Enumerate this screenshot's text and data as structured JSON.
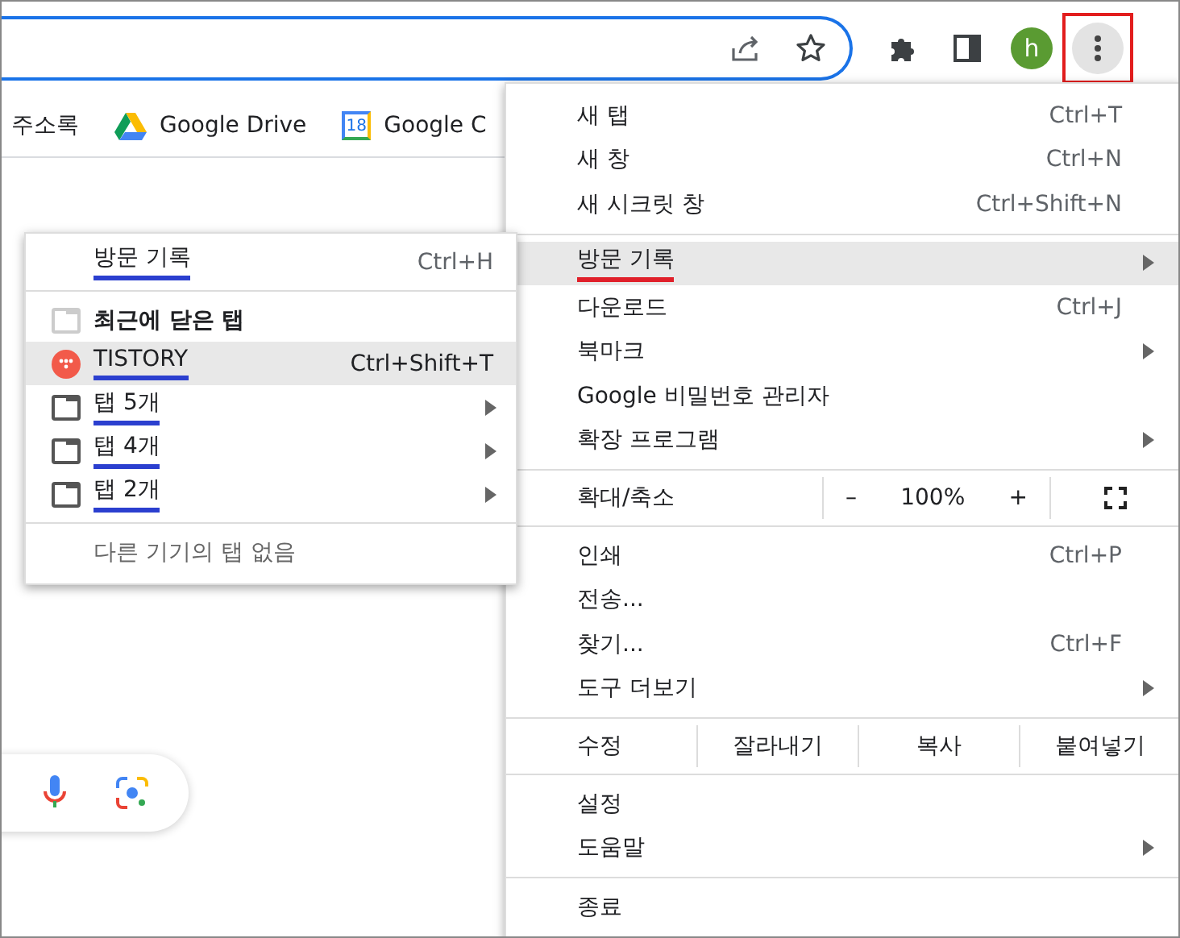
{
  "toolbar": {
    "avatar": "h",
    "menu_button_highlighted": true
  },
  "bookmarks": [
    {
      "label": "주소록",
      "kind": "plain"
    },
    {
      "label": "Google Drive",
      "kind": "drive"
    },
    {
      "label": "Google C",
      "kind": "calendar",
      "icon_text": "18"
    }
  ],
  "main_menu": [
    {
      "kind": "item",
      "label": "새 탭",
      "shortcut": "Ctrl+T",
      "submenu": false,
      "selected": false,
      "underlined": false
    },
    {
      "kind": "item",
      "label": "새 창",
      "shortcut": "Ctrl+N",
      "submenu": false,
      "selected": false,
      "underlined": false
    },
    {
      "kind": "item",
      "label": "새 시크릿 창",
      "shortcut": "Ctrl+Shift+N",
      "submenu": false,
      "selected": false,
      "underlined": false
    },
    {
      "kind": "divider"
    },
    {
      "kind": "item",
      "label": "방문 기록",
      "submenu": true,
      "selected": true,
      "underlined": true
    },
    {
      "kind": "item",
      "label": "다운로드",
      "shortcut": "Ctrl+J",
      "submenu": false,
      "selected": false,
      "underlined": false
    },
    {
      "kind": "item",
      "label": "북마크",
      "submenu": true,
      "selected": false,
      "underlined": false
    },
    {
      "kind": "item",
      "label": "Google 비밀번호 관리자",
      "submenu": false,
      "selected": false,
      "underlined": false
    },
    {
      "kind": "item",
      "label": "확장 프로그램",
      "submenu": true,
      "selected": false,
      "underlined": false
    },
    {
      "kind": "divider"
    },
    {
      "kind": "zoom",
      "label": "확대/축소",
      "minus": "–",
      "value": "100%",
      "plus": "+"
    },
    {
      "kind": "divider"
    },
    {
      "kind": "item",
      "label": "인쇄",
      "shortcut": "Ctrl+P",
      "submenu": false,
      "selected": false,
      "underlined": false
    },
    {
      "kind": "item",
      "label": "전송...",
      "submenu": false,
      "selected": false,
      "underlined": false
    },
    {
      "kind": "item",
      "label": "찾기...",
      "shortcut": "Ctrl+F",
      "submenu": false,
      "selected": false,
      "underlined": false
    },
    {
      "kind": "item",
      "label": "도구 더보기",
      "submenu": true,
      "selected": false,
      "underlined": false
    },
    {
      "kind": "divider"
    },
    {
      "kind": "edit",
      "label": "수정",
      "actions": [
        "잘라내기",
        "복사",
        "붙여넣기"
      ]
    },
    {
      "kind": "divider"
    },
    {
      "kind": "item",
      "label": "설정",
      "submenu": false,
      "selected": false,
      "underlined": false
    },
    {
      "kind": "item",
      "label": "도움말",
      "submenu": true,
      "selected": false,
      "underlined": false
    },
    {
      "kind": "divider"
    },
    {
      "kind": "item",
      "label": "종료",
      "submenu": false,
      "selected": false,
      "underlined": false
    }
  ],
  "history_menu": [
    {
      "kind": "header",
      "label": "방문 기록",
      "shortcut": "Ctrl+H",
      "underlined": true
    },
    {
      "kind": "divider"
    },
    {
      "kind": "section",
      "label": "최근에 닫은 탭"
    },
    {
      "kind": "site",
      "label": "TISTORY",
      "shortcut": "Ctrl+Shift+T",
      "submenu": false,
      "selected": true,
      "underlined": true
    },
    {
      "kind": "window",
      "label": "탭 5개",
      "submenu": true,
      "selected": false,
      "underlined": true
    },
    {
      "kind": "window",
      "label": "탭 4개",
      "submenu": true,
      "selected": false,
      "underlined": true
    },
    {
      "kind": "window",
      "label": "탭 2개",
      "submenu": true,
      "selected": false,
      "underlined": true
    },
    {
      "kind": "divider"
    },
    {
      "kind": "note",
      "label": "다른 기기의 탭 없음"
    }
  ]
}
